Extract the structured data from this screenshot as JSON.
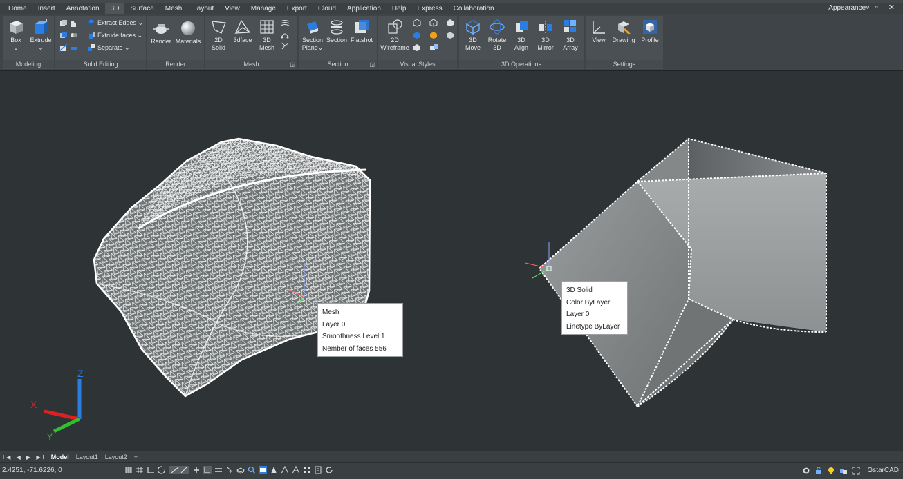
{
  "menu": {
    "tabs": [
      "Home",
      "Insert",
      "Annotation",
      "3D",
      "Surface",
      "Mesh",
      "Layout",
      "View",
      "Manage",
      "Export",
      "Cloud",
      "Application",
      "Help",
      "Express",
      "Collaboration"
    ],
    "active_tab": "3D",
    "appearance": "Appearance",
    "window_controls": "– ▫ ✕"
  },
  "ribbon": {
    "modeling": {
      "title": "Modeling",
      "box": "Box",
      "extrude": "Extrude"
    },
    "solid_editing": {
      "title": "Solid Editing",
      "extract_edges": "Extract Edges",
      "extrude_faces": "Extrude faces",
      "separate": "Separate"
    },
    "render": {
      "title": "Render",
      "render": "Render",
      "materials": "Materials"
    },
    "mesh": {
      "title": "Mesh",
      "solid2d_l1": "2D",
      "solid2d_l2": "Solid",
      "face3d": "3dface",
      "mesh3d_l1": "3D",
      "mesh3d_l2": "Mesh"
    },
    "section": {
      "title": "Section",
      "plane_l1": "Section",
      "plane_l2": "Plane",
      "section": "Section",
      "flatshot": "Flatshot"
    },
    "visual_styles": {
      "title": "Visual Styles",
      "wire_l1": "2D",
      "wire_l2": "Wireframe"
    },
    "ops3d": {
      "title": "3D Operations",
      "move_l1": "3D",
      "move_l2": "Move",
      "rotate_l1": "Rotate",
      "rotate_l2": "3D",
      "align_l1": "3D",
      "align_l2": "Align",
      "mirror_l1": "3D",
      "mirror_l2": "Mirror",
      "array_l1": "3D",
      "array_l2": "Array"
    },
    "settings": {
      "title": "Settings",
      "view": "View",
      "drawing": "Drawing",
      "profile": "Profile"
    }
  },
  "tooltip_mesh": {
    "title": "Mesh",
    "layer": "Layer  0",
    "smoothness": "Smoothness  Level 1",
    "faces": "Nember of faces  556"
  },
  "tooltip_solid": {
    "title": "3D Solid",
    "color": "Color  ByLayer",
    "layer": "Layer  0",
    "linetype": "Linetype  ByLayer"
  },
  "ucs": {
    "x": "X",
    "y": "Y",
    "z": "Z"
  },
  "layouts": {
    "nav": "I◀ ◀ ▶ ▶I",
    "tabs": [
      "Model",
      "Layout1",
      "Layout2",
      "+"
    ],
    "active": "Model"
  },
  "status": {
    "coords": "2.4251, -71.6226, 0",
    "brand": "GstarCAD"
  },
  "colors": {
    "background": "#2e3336",
    "ribbon": "#3e4447",
    "accent": "#2a7de1"
  }
}
